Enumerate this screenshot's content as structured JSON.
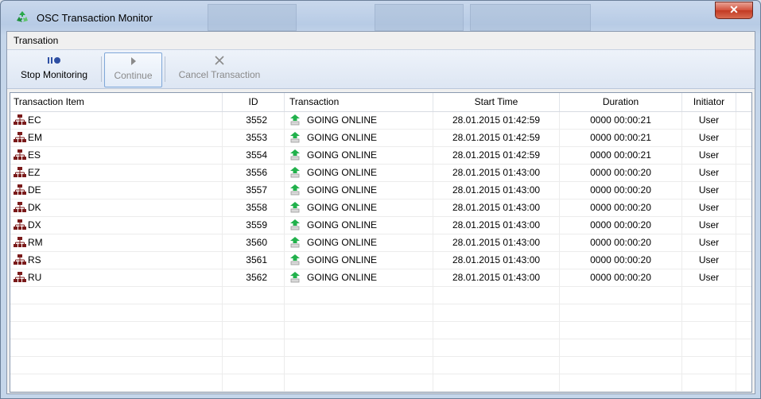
{
  "window": {
    "title": "OSC Transaction Monitor",
    "close_glyph": "✕"
  },
  "menu": {
    "items": [
      {
        "label": "Transation"
      }
    ]
  },
  "toolbar": {
    "stop": {
      "label": "Stop Monitoring",
      "icon": "stop-monitoring-icon",
      "enabled": true
    },
    "continue": {
      "label": "Continue",
      "icon": "play-icon",
      "enabled": false
    },
    "cancel": {
      "label": "Cancel Transaction",
      "icon": "cancel-x-icon",
      "enabled": false
    }
  },
  "table": {
    "columns": [
      "Transaction Item",
      "ID",
      "Transaction",
      "Start Time",
      "Duration",
      "Initiator"
    ],
    "rows": [
      {
        "item": "EC",
        "id": "3552",
        "transaction": "GOING ONLINE",
        "start": "28.01.2015 01:42:59",
        "duration": "0000 00:00:21",
        "initiator": "User"
      },
      {
        "item": "EM",
        "id": "3553",
        "transaction": "GOING ONLINE",
        "start": "28.01.2015 01:42:59",
        "duration": "0000 00:00:21",
        "initiator": "User"
      },
      {
        "item": "ES",
        "id": "3554",
        "transaction": "GOING ONLINE",
        "start": "28.01.2015 01:42:59",
        "duration": "0000 00:00:21",
        "initiator": "User"
      },
      {
        "item": "EZ",
        "id": "3556",
        "transaction": "GOING ONLINE",
        "start": "28.01.2015 01:43:00",
        "duration": "0000 00:00:20",
        "initiator": "User"
      },
      {
        "item": "DE",
        "id": "3557",
        "transaction": "GOING ONLINE",
        "start": "28.01.2015 01:43:00",
        "duration": "0000 00:00:20",
        "initiator": "User"
      },
      {
        "item": "DK",
        "id": "3558",
        "transaction": "GOING ONLINE",
        "start": "28.01.2015 01:43:00",
        "duration": "0000 00:00:20",
        "initiator": "User"
      },
      {
        "item": "DX",
        "id": "3559",
        "transaction": "GOING ONLINE",
        "start": "28.01.2015 01:43:00",
        "duration": "0000 00:00:20",
        "initiator": "User"
      },
      {
        "item": "RM",
        "id": "3560",
        "transaction": "GOING ONLINE",
        "start": "28.01.2015 01:43:00",
        "duration": "0000 00:00:20",
        "initiator": "User"
      },
      {
        "item": "RS",
        "id": "3561",
        "transaction": "GOING ONLINE",
        "start": "28.01.2015 01:43:00",
        "duration": "0000 00:00:20",
        "initiator": "User"
      },
      {
        "item": "RU",
        "id": "3562",
        "transaction": "GOING ONLINE",
        "start": "28.01.2015 01:43:00",
        "duration": "0000 00:00:20",
        "initiator": "User"
      }
    ],
    "empty_rows": 6
  },
  "colors": {
    "accent": "#2e4fa3",
    "online_green": "#22b14c",
    "item_icon": "#7a1a1a"
  }
}
